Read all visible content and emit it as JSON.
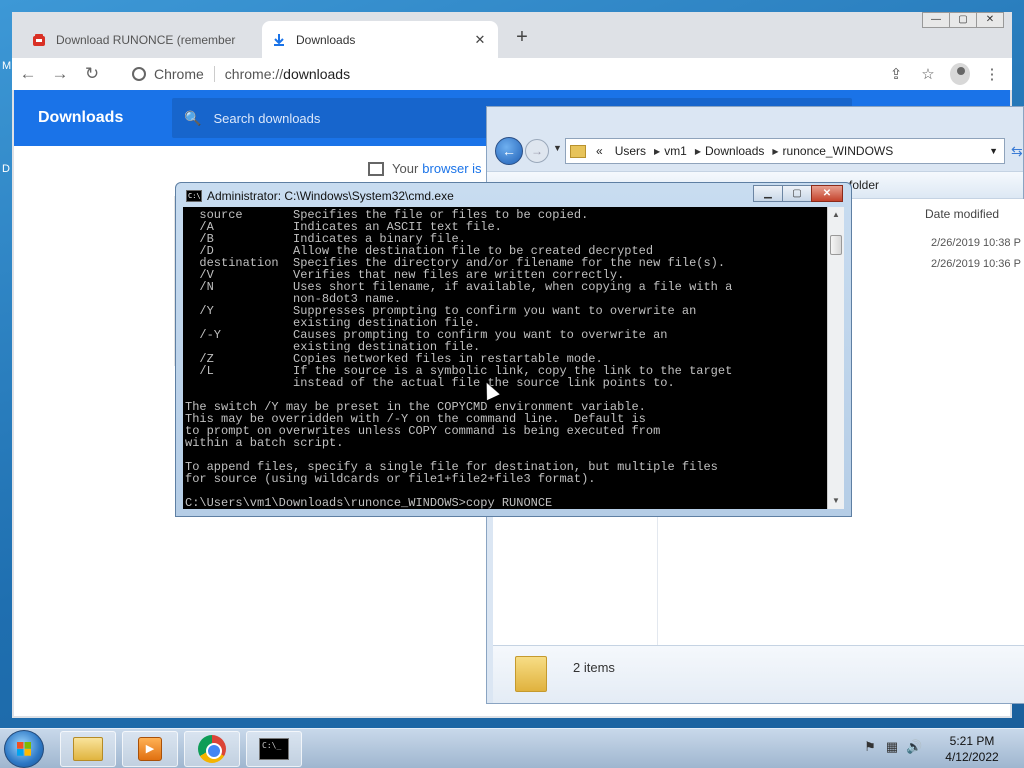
{
  "desktop": {
    "fragment_1": "M",
    "fragment_2": "D"
  },
  "browser": {
    "tabs": [
      {
        "title": "Download RUNONCE (remember"
      },
      {
        "title": "Downloads"
      }
    ],
    "new_tab": "+",
    "window_controls": {
      "minimize": "—",
      "maximize": "▢",
      "close": "✕"
    },
    "omnibox": {
      "chip": "Chrome",
      "url_prefix": "chrome://",
      "url_host": "downloads"
    },
    "page": {
      "title": "Downloads",
      "search_placeholder": "Search downloads",
      "managed_text": "Your",
      "managed_link": "browser is"
    }
  },
  "explorer": {
    "breadcrumb": [
      "«",
      "Users",
      "vm1",
      "Downloads",
      "runonce_WINDOWS"
    ],
    "command_new_folder": "w folder",
    "column_header": "Date modified",
    "rows": [
      {
        "date_modified": "2/26/2019 10:38 P"
      },
      {
        "date_modified": "2/26/2019 10:36 P"
      }
    ],
    "details": "2 items"
  },
  "cmd": {
    "title": "Administrator: C:\\Windows\\System32\\cmd.exe",
    "lines": [
      "  source       Specifies the file or files to be copied.",
      "  /A           Indicates an ASCII text file.",
      "  /B           Indicates a binary file.",
      "  /D           Allow the destination file to be created decrypted",
      "  destination  Specifies the directory and/or filename for the new file(s).",
      "  /V           Verifies that new files are written correctly.",
      "  /N           Uses short filename, if available, when copying a file with a",
      "               non-8dot3 name.",
      "  /Y           Suppresses prompting to confirm you want to overwrite an",
      "               existing destination file.",
      "  /-Y          Causes prompting to confirm you want to overwrite an",
      "               existing destination file.",
      "  /Z           Copies networked files in restartable mode.",
      "  /L           If the source is a symbolic link, copy the link to the target",
      "               instead of the actual file the source link points to.",
      "",
      "The switch /Y may be preset in the COPYCMD environment variable.",
      "This may be overridden with /-Y on the command line.  Default is",
      "to prompt on overwrites unless COPY command is being executed from",
      "within a batch script.",
      "",
      "To append files, specify a single file for destination, but multiple files",
      "for source (using wildcards or file1+file2+file3 format).",
      "",
      "C:\\Users\\vm1\\Downloads\\runonce_WINDOWS>copy RUNONCE"
    ]
  },
  "taskbar": {
    "clock_time": "5:21 PM",
    "clock_date": "4/12/2022"
  },
  "colors": {
    "chrome_blue": "#1a73e8",
    "cmd_background": "#000000",
    "cmd_text": "#c0c0c0"
  }
}
